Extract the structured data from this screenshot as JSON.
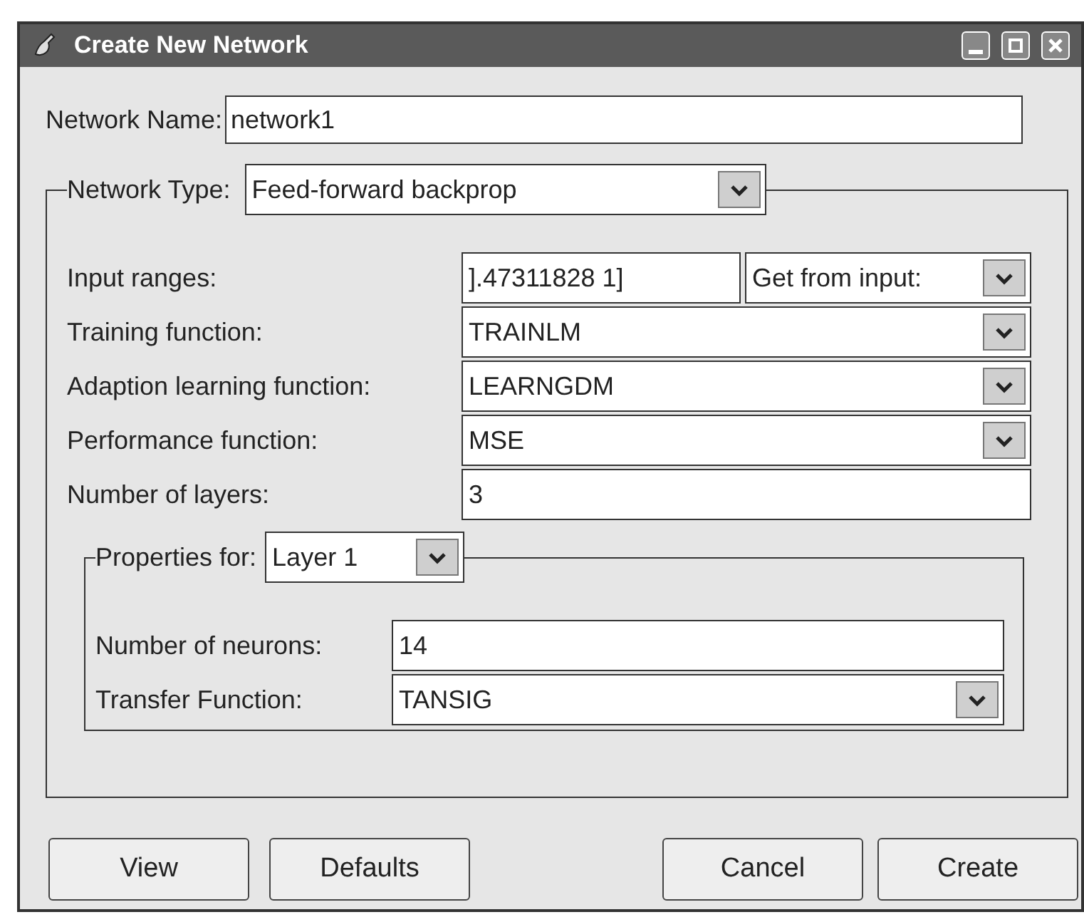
{
  "window": {
    "title": "Create New Network"
  },
  "network_name": {
    "label": "Network Name:",
    "value": "network1"
  },
  "network_type": {
    "label": "Network Type:",
    "value": "Feed-forward backprop"
  },
  "fields": [
    {
      "label": "Input ranges:",
      "kind": "text_with_dropdown",
      "value": "].47311828 1]",
      "dropdown": "Get from input:"
    },
    {
      "label": "Training function:",
      "kind": "dropdown",
      "value": "TRAINLM"
    },
    {
      "label": "Adaption learning function:",
      "kind": "dropdown",
      "value": "LEARNGDM"
    },
    {
      "label": "Performance function:",
      "kind": "dropdown",
      "value": "MSE"
    },
    {
      "label": "Number of layers:",
      "kind": "text",
      "value": "3"
    }
  ],
  "properties": {
    "label": "Properties for:",
    "value": "Layer 1",
    "fields": [
      {
        "label": "Number of neurons:",
        "kind": "text",
        "value": "14"
      },
      {
        "label": "Transfer Function:",
        "kind": "dropdown",
        "value": "TANSIG"
      }
    ]
  },
  "buttons": [
    "View",
    "Defaults",
    "Cancel",
    "Create"
  ]
}
